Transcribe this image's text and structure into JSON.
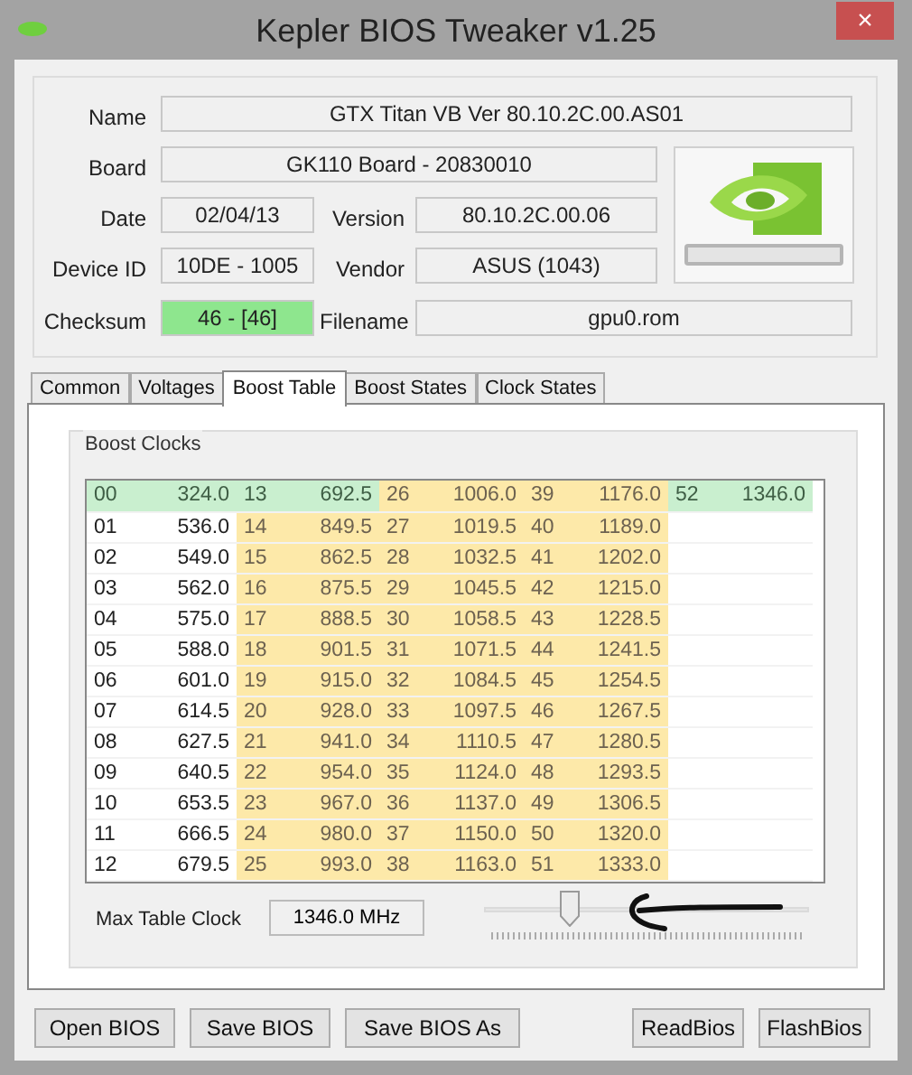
{
  "window": {
    "title": "Kepler BIOS Tweaker v1.25",
    "close": "×"
  },
  "info": {
    "fields": [
      {
        "label": "Name",
        "value": "GTX Titan VB Ver 80.10.2C.00.AS01",
        "kind": "plain"
      },
      {
        "label": "Board",
        "value": "GK110 Board - 20830010",
        "kind": "plain"
      },
      {
        "label": "Date",
        "value": "02/04/13",
        "kind": "plain"
      },
      {
        "label": "Version",
        "value": "80.10.2C.00.06",
        "kind": "plain"
      },
      {
        "label": "Device ID",
        "value": "10DE - 1005",
        "kind": "plain"
      },
      {
        "label": "Vendor",
        "value": "ASUS (1043)",
        "kind": "plain"
      },
      {
        "label": "Checksum",
        "value": "46 - [46]",
        "kind": "valid"
      },
      {
        "label": "Filename",
        "value": "gpu0.rom",
        "kind": "plain"
      }
    ]
  },
  "tabs": [
    {
      "label": "Common",
      "selected": false
    },
    {
      "label": "Voltages",
      "selected": false
    },
    {
      "label": "Boost Table",
      "selected": true
    },
    {
      "label": "Boost States",
      "selected": false
    },
    {
      "label": "Clock States",
      "selected": false
    }
  ],
  "boost_clocks": {
    "title": "Boost Clocks",
    "rows": [
      [
        {
          "index": "00",
          "clock": "324.0",
          "kind": "marked"
        },
        {
          "index": "13",
          "clock": "692.5",
          "kind": "marked"
        },
        {
          "index": "26",
          "clock": "1006.0",
          "kind": "boost"
        },
        {
          "index": "39",
          "clock": "1176.0",
          "kind": "boost"
        },
        {
          "index": "52",
          "clock": "1346.0",
          "kind": "marked"
        }
      ],
      [
        {
          "index": "01",
          "clock": "536.0",
          "kind": "plain"
        },
        {
          "index": "14",
          "clock": "849.5",
          "kind": "boost"
        },
        {
          "index": "27",
          "clock": "1019.5",
          "kind": "boost"
        },
        {
          "index": "40",
          "clock": "1189.0",
          "kind": "boost"
        }
      ],
      [
        {
          "index": "02",
          "clock": "549.0",
          "kind": "plain"
        },
        {
          "index": "15",
          "clock": "862.5",
          "kind": "boost"
        },
        {
          "index": "28",
          "clock": "1032.5",
          "kind": "boost"
        },
        {
          "index": "41",
          "clock": "1202.0",
          "kind": "boost"
        }
      ],
      [
        {
          "index": "03",
          "clock": "562.0",
          "kind": "plain"
        },
        {
          "index": "16",
          "clock": "875.5",
          "kind": "boost"
        },
        {
          "index": "29",
          "clock": "1045.5",
          "kind": "boost"
        },
        {
          "index": "42",
          "clock": "1215.0",
          "kind": "boost"
        }
      ],
      [
        {
          "index": "04",
          "clock": "575.0",
          "kind": "plain"
        },
        {
          "index": "17",
          "clock": "888.5",
          "kind": "boost"
        },
        {
          "index": "30",
          "clock": "1058.5",
          "kind": "boost"
        },
        {
          "index": "43",
          "clock": "1228.5",
          "kind": "boost"
        }
      ],
      [
        {
          "index": "05",
          "clock": "588.0",
          "kind": "plain"
        },
        {
          "index": "18",
          "clock": "901.5",
          "kind": "boost"
        },
        {
          "index": "31",
          "clock": "1071.5",
          "kind": "boost"
        },
        {
          "index": "44",
          "clock": "1241.5",
          "kind": "boost"
        }
      ],
      [
        {
          "index": "06",
          "clock": "601.0",
          "kind": "plain"
        },
        {
          "index": "19",
          "clock": "915.0",
          "kind": "boost"
        },
        {
          "index": "32",
          "clock": "1084.5",
          "kind": "boost"
        },
        {
          "index": "45",
          "clock": "1254.5",
          "kind": "boost"
        }
      ],
      [
        {
          "index": "07",
          "clock": "614.5",
          "kind": "plain"
        },
        {
          "index": "20",
          "clock": "928.0",
          "kind": "boost"
        },
        {
          "index": "33",
          "clock": "1097.5",
          "kind": "boost"
        },
        {
          "index": "46",
          "clock": "1267.5",
          "kind": "boost"
        }
      ],
      [
        {
          "index": "08",
          "clock": "627.5",
          "kind": "plain"
        },
        {
          "index": "21",
          "clock": "941.0",
          "kind": "boost"
        },
        {
          "index": "34",
          "clock": "1110.5",
          "kind": "boost"
        },
        {
          "index": "47",
          "clock": "1280.5",
          "kind": "boost"
        }
      ],
      [
        {
          "index": "09",
          "clock": "640.5",
          "kind": "plain"
        },
        {
          "index": "22",
          "clock": "954.0",
          "kind": "boost"
        },
        {
          "index": "35",
          "clock": "1124.0",
          "kind": "boost"
        },
        {
          "index": "48",
          "clock": "1293.5",
          "kind": "boost"
        }
      ],
      [
        {
          "index": "10",
          "clock": "653.5",
          "kind": "plain"
        },
        {
          "index": "23",
          "clock": "967.0",
          "kind": "boost"
        },
        {
          "index": "36",
          "clock": "1137.0",
          "kind": "boost"
        },
        {
          "index": "49",
          "clock": "1306.5",
          "kind": "boost"
        }
      ],
      [
        {
          "index": "11",
          "clock": "666.5",
          "kind": "plain"
        },
        {
          "index": "24",
          "clock": "980.0",
          "kind": "boost"
        },
        {
          "index": "37",
          "clock": "1150.0",
          "kind": "boost"
        },
        {
          "index": "50",
          "clock": "1320.0",
          "kind": "boost"
        }
      ],
      [
        {
          "index": "12",
          "clock": "679.5",
          "kind": "plain"
        },
        {
          "index": "25",
          "clock": "993.0",
          "kind": "boost"
        },
        {
          "index": "38",
          "clock": "1163.0",
          "kind": "boost"
        },
        {
          "index": "51",
          "clock": "1333.0",
          "kind": "boost"
        }
      ]
    ],
    "max_clock": {
      "label": "Max Table Clock",
      "value": "1346.0 MHz"
    },
    "slider": {
      "level": 0.25
    }
  },
  "buttons": {
    "left": [
      "Open BIOS",
      "Save BIOS",
      "Save BIOS As"
    ],
    "right": [
      "ReadBios",
      "FlashBios"
    ]
  }
}
